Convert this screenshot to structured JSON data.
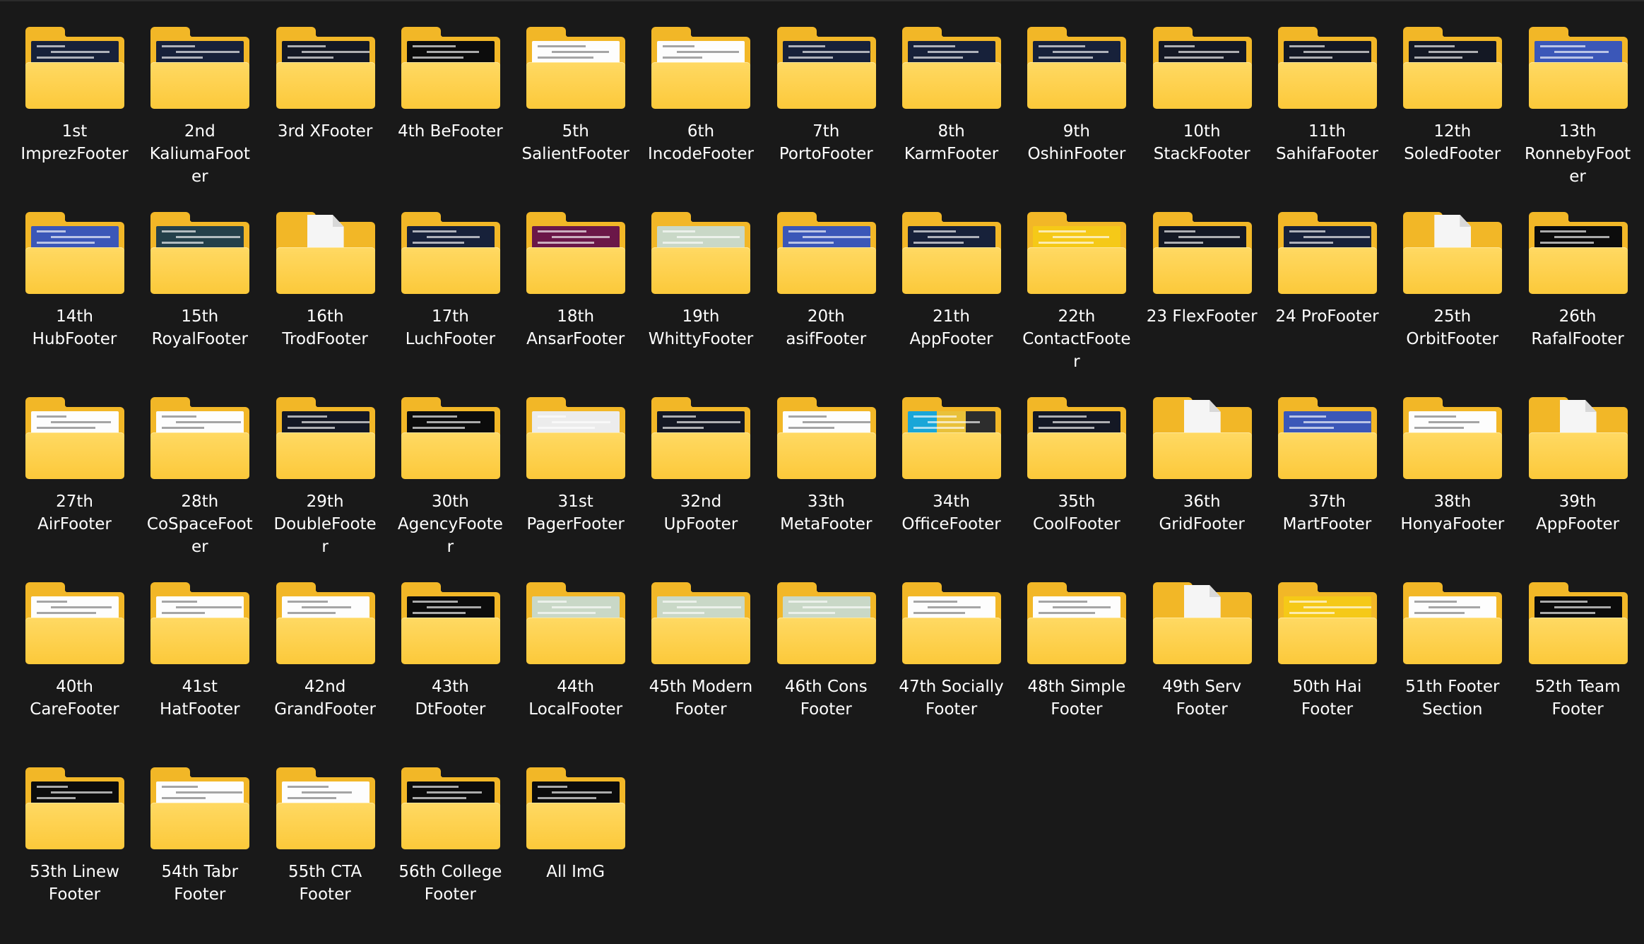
{
  "colors": {
    "background": "#191919",
    "folder": "#f2b727",
    "folder_front": "#fcc93a",
    "label": "#ffffff"
  },
  "folders": [
    {
      "name": "1st ImprezFooter",
      "label": "1st\nImprezFooter",
      "preview": "navy",
      "icon": "folder-icon"
    },
    {
      "name": "2nd KaliumaFooter",
      "label": "2nd\nKaliumaFoot\ner",
      "preview": "navy",
      "icon": "folder-icon"
    },
    {
      "name": "3rd XFooter",
      "label": "3rd XFooter",
      "preview": "dark",
      "icon": "folder-icon"
    },
    {
      "name": "4th BeFooter",
      "label": "4th BeFooter",
      "preview": "black",
      "icon": "folder-icon"
    },
    {
      "name": "5th SalientFooter",
      "label": "5th\nSalientFooter",
      "preview": "light",
      "icon": "folder-icon"
    },
    {
      "name": "6th IncodeFooter",
      "label": "6th\nIncodeFooter",
      "preview": "light",
      "icon": "folder-icon"
    },
    {
      "name": "7th PortoFooter",
      "label": "7th\nPortoFooter",
      "preview": "navy",
      "icon": "folder-icon"
    },
    {
      "name": "8th KarmFooter",
      "label": "8th\nKarmFooter",
      "preview": "navy",
      "icon": "folder-icon"
    },
    {
      "name": "9th OshinFooter",
      "label": "9th\nOshinFooter",
      "preview": "navy",
      "icon": "folder-icon"
    },
    {
      "name": "10th StackFooter",
      "label": "10th\nStackFooter",
      "preview": "dark",
      "icon": "folder-icon"
    },
    {
      "name": "11th SahifaFooter",
      "label": "11th\nSahifaFooter",
      "preview": "dark",
      "icon": "folder-icon"
    },
    {
      "name": "12th SoledFooter",
      "label": "12th\nSoledFooter",
      "preview": "dark",
      "icon": "folder-icon"
    },
    {
      "name": "13th RonnebyFooter",
      "label": "13th\nRonnebyFoot\ner",
      "preview": "blue",
      "icon": "folder-icon"
    },
    {
      "name": "14th HubFooter",
      "label": "14th\nHubFooter",
      "preview": "blue",
      "icon": "folder-icon"
    },
    {
      "name": "15th RoyalFooter",
      "label": "15th\nRoyalFooter",
      "preview": "teal",
      "icon": "folder-icon"
    },
    {
      "name": "16th TrodFooter",
      "label": "16th\nTrodFooter",
      "preview": "empty",
      "icon": "empty-folder-icon"
    },
    {
      "name": "17th LuchFooter",
      "label": "17th\nLuchFooter",
      "preview": "navy",
      "icon": "folder-icon"
    },
    {
      "name": "18th AnsarFooter",
      "label": "18th\nAnsarFooter",
      "preview": "plum",
      "icon": "folder-icon"
    },
    {
      "name": "19th WhittyFooter",
      "label": "19th\nWhittyFooter",
      "preview": "map",
      "icon": "folder-icon"
    },
    {
      "name": "20th asifFooter",
      "label": "20th\nasifFooter",
      "preview": "blue",
      "icon": "folder-icon"
    },
    {
      "name": "21th AppFooter",
      "label": "21th\nAppFooter",
      "preview": "navy",
      "icon": "folder-icon"
    },
    {
      "name": "22th ContactFooter",
      "label": "22th\nContactFoote\nr",
      "preview": "yellow",
      "icon": "folder-icon"
    },
    {
      "name": "23 FlexFooter",
      "label": "23 FlexFooter",
      "preview": "dark",
      "icon": "folder-icon"
    },
    {
      "name": "24 ProFooter",
      "label": "24 ProFooter",
      "preview": "navy",
      "icon": "folder-icon"
    },
    {
      "name": "25th OrbitFooter",
      "label": "25th\nOrbitFooter",
      "preview": "empty",
      "icon": "empty-folder-icon"
    },
    {
      "name": "26th RafalFooter",
      "label": "26th\nRafalFooter",
      "preview": "black",
      "icon": "folder-icon"
    },
    {
      "name": "27th AirFooter",
      "label": "27th\nAirFooter",
      "preview": "light",
      "icon": "folder-icon"
    },
    {
      "name": "28th CoSpaceFooter",
      "label": "28th\nCoSpaceFoot\ner",
      "preview": "light",
      "icon": "folder-icon"
    },
    {
      "name": "29th DoubleFooter",
      "label": "29th\nDoubleFoote\nr",
      "preview": "dark",
      "icon": "folder-icon"
    },
    {
      "name": "30th AgencyFooter",
      "label": "30th\nAgencyFoote\nr",
      "preview": "black",
      "icon": "folder-icon"
    },
    {
      "name": "31st PagerFooter",
      "label": "31st\nPagerFooter",
      "preview": "gray",
      "icon": "folder-icon"
    },
    {
      "name": "32nd UpFooter",
      "label": "32nd\nUpFooter",
      "preview": "dark",
      "icon": "folder-icon"
    },
    {
      "name": "33th MetaFooter",
      "label": "33th\nMetaFooter",
      "preview": "light",
      "icon": "folder-icon"
    },
    {
      "name": "34th OfficeFooter",
      "label": "34th\nOfficeFooter",
      "preview": "mixed",
      "icon": "folder-icon"
    },
    {
      "name": "35th CoolFooter",
      "label": "35th\nCoolFooter",
      "preview": "dark",
      "icon": "folder-icon"
    },
    {
      "name": "36th GridFooter",
      "label": "36th\nGridFooter",
      "preview": "empty",
      "icon": "empty-folder-icon"
    },
    {
      "name": "37th MartFooter",
      "label": "37th\nMartFooter",
      "preview": "blue",
      "icon": "folder-icon"
    },
    {
      "name": "38th HonyaFooter",
      "label": "38th\nHonyaFooter",
      "preview": "light",
      "icon": "folder-icon"
    },
    {
      "name": "39th AppFooter",
      "label": "39th\nAppFooter",
      "preview": "empty",
      "icon": "empty-folder-icon"
    },
    {
      "name": "40th CareFooter",
      "label": "40th\nCareFooter",
      "preview": "light",
      "icon": "folder-icon"
    },
    {
      "name": "41st HatFooter",
      "label": "41st\nHatFooter",
      "preview": "light",
      "icon": "folder-icon"
    },
    {
      "name": "42nd GrandFooter",
      "label": "42nd\nGrandFooter",
      "preview": "light",
      "icon": "folder-icon"
    },
    {
      "name": "43th DtFooter",
      "label": "43th\nDtFooter",
      "preview": "black",
      "icon": "folder-icon"
    },
    {
      "name": "44th LocalFooter",
      "label": "44th\nLocalFooter",
      "preview": "map",
      "icon": "folder-icon"
    },
    {
      "name": "45th Modern Footer",
      "label": "45th Modern\nFooter",
      "preview": "map",
      "icon": "folder-icon"
    },
    {
      "name": "46th Cons Footer",
      "label": "46th Cons\nFooter",
      "preview": "map",
      "icon": "folder-icon"
    },
    {
      "name": "47th Socially Footer",
      "label": "47th Socially\nFooter",
      "preview": "light",
      "icon": "folder-icon"
    },
    {
      "name": "48th Simple Footer",
      "label": "48th Simple\nFooter",
      "preview": "light",
      "icon": "folder-icon"
    },
    {
      "name": "49th Serv Footer",
      "label": "49th Serv\nFooter",
      "preview": "empty",
      "icon": "empty-folder-icon"
    },
    {
      "name": "50th Hai Footer",
      "label": "50th Hai\nFooter",
      "preview": "yellow",
      "icon": "folder-icon"
    },
    {
      "name": "51th Footer Section",
      "label": "51th Footer\nSection",
      "preview": "light",
      "icon": "folder-icon"
    },
    {
      "name": "52th Team Footer",
      "label": "52th Team\nFooter",
      "preview": "black",
      "icon": "folder-icon"
    },
    {
      "name": "53th Linew Footer",
      "label": "53th Linew\nFooter",
      "preview": "black",
      "icon": "folder-icon"
    },
    {
      "name": "54th Tabr Footer",
      "label": "54th Tabr\nFooter",
      "preview": "light",
      "icon": "folder-icon"
    },
    {
      "name": "55th CTA Footer",
      "label": "55th CTA\nFooter",
      "preview": "light",
      "icon": "folder-icon"
    },
    {
      "name": "56th College Footer",
      "label": "56th College\nFooter",
      "preview": "black",
      "icon": "folder-icon"
    },
    {
      "name": "All ImG",
      "label": "All ImG",
      "preview": "black",
      "icon": "folder-icon"
    }
  ]
}
